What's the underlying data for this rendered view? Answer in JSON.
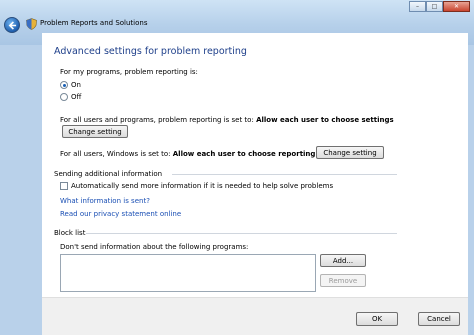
{
  "window": {
    "title": "Problem Reports and Solutions",
    "buttons": {
      "minimize": "–",
      "maximize": "□",
      "close": "✕"
    }
  },
  "main": {
    "heading": "Advanced settings for problem reporting",
    "my_programs": {
      "label": "For my programs, problem reporting is:",
      "options": [
        "On",
        "Off"
      ],
      "selected": "On"
    },
    "all_users_programs": {
      "prefix": "For all users and programs, problem reporting is set to:",
      "value": "Allow each user to choose settings",
      "button": "Change setting"
    },
    "all_users_windows": {
      "prefix": "For all users, Windows is set to:",
      "value": "Allow each user to choose reporting settings",
      "button": "Change setting"
    },
    "sending": {
      "group_label": "Sending additional information",
      "checkbox_label": "Automatically send more information if it is needed to help solve problems",
      "checked": false,
      "link1": "What information is sent?",
      "link2": "Read our privacy statement online"
    },
    "block_list": {
      "group_label": "Block list",
      "label": "Don't send information about the following programs:",
      "add": "Add...",
      "remove": "Remove"
    }
  },
  "footer": {
    "ok": "OK",
    "cancel": "Cancel"
  },
  "colors": {
    "heading": "#1e3f8a",
    "link": "#1a4fb4",
    "frame": "#b9d1ea"
  }
}
